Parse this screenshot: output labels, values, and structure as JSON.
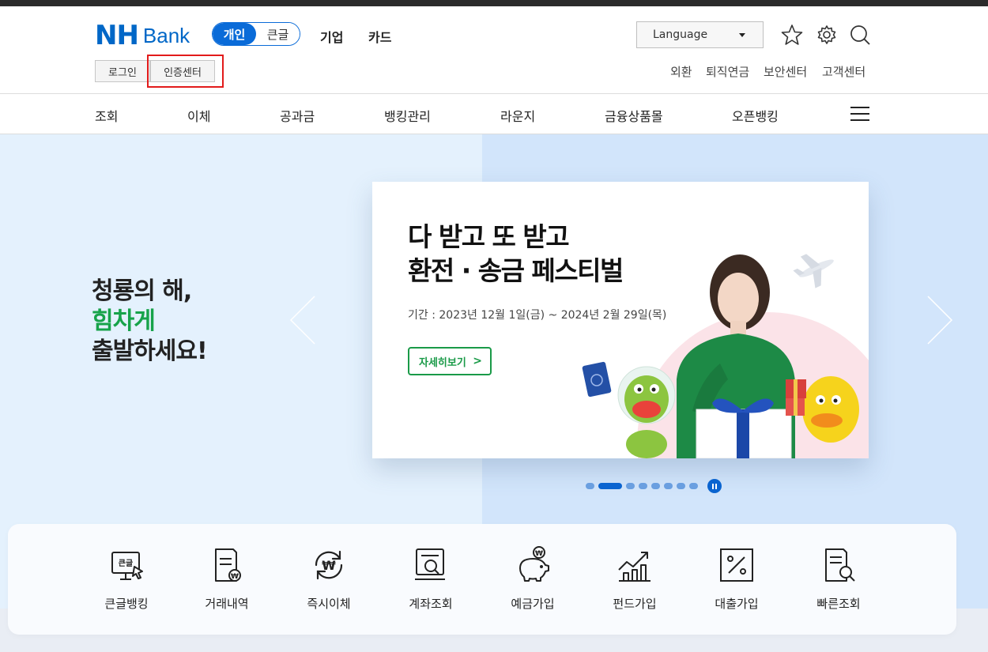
{
  "header": {
    "logo_nh": "NH",
    "logo_bank": "Bank",
    "segments": [
      "개인",
      "큰글"
    ],
    "links": [
      "기업",
      "카드"
    ],
    "language_label": "Language",
    "login_label": "로그인",
    "cert_label": "인증센터",
    "util_links": [
      "외환",
      "퇴직연금",
      "보안센터",
      "고객센터"
    ]
  },
  "icons": {
    "favorite": "star-icon",
    "settings": "gear-icon",
    "search": "search-icon",
    "menu": "hamburger-menu-icon"
  },
  "nav": {
    "items": [
      "조회",
      "이체",
      "공과금",
      "뱅킹관리",
      "라운지",
      "금융상품몰",
      "오픈뱅킹"
    ]
  },
  "hero": {
    "slogan_line1": "청룡의 해,",
    "slogan_line2": "힘차게",
    "slogan_line3": "출발하세요!",
    "banner_title_line1": "다 받고 또 받고",
    "banner_title_line2": "환전 · 송금 페스티벌",
    "banner_period": "기간 : 2023년 12월 1일(금) ~ 2024년 2월 29일(목)",
    "banner_button": "자세히보기",
    "slide_count": 8,
    "active_slide": 2
  },
  "quick_menu": {
    "items": [
      "큰글뱅킹",
      "거래내역",
      "즉시이체",
      "계좌조회",
      "예금가입",
      "펀드가입",
      "대출가입",
      "빠른조회"
    ]
  },
  "colors": {
    "brand_blue": "#0067c7",
    "accent_green": "#17a34a",
    "highlight_red": "#e21b1b"
  }
}
